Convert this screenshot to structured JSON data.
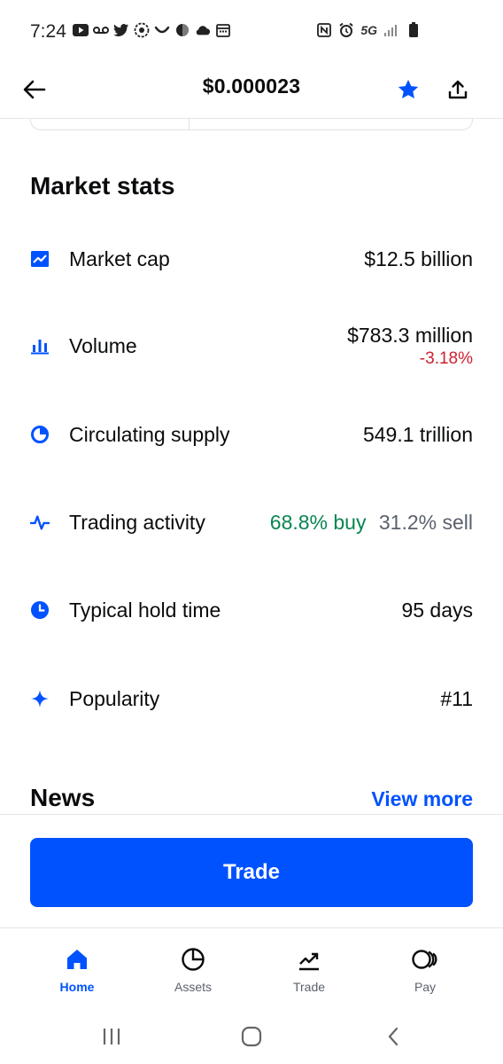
{
  "status_bar": {
    "time": "7:24",
    "network": "5G",
    "left_icons": [
      "youtube-icon",
      "voicemail-icon",
      "twitter-icon",
      "signal-app-icon",
      "smile-icon",
      "app-icon",
      "cloud-icon",
      "calendar-icon"
    ],
    "right_icons": [
      "nfc-icon",
      "alarm-icon",
      "network-5g-icon",
      "cell-signal-icon",
      "battery-icon"
    ]
  },
  "header": {
    "price": "$0.000023",
    "star_color": "#0052ff"
  },
  "market_stats": {
    "title": "Market stats",
    "rows": [
      {
        "icon": "line-chart-icon",
        "label": "Market cap",
        "value": "$12.5 billion"
      },
      {
        "icon": "bar-chart-icon",
        "label": "Volume",
        "value": "$783.3 million",
        "change": "-3.18%"
      },
      {
        "icon": "pie-chart-icon",
        "label": "Circulating supply",
        "value": "549.1 trillion"
      },
      {
        "icon": "pulse-icon",
        "label": "Trading activity",
        "buy": "68.8% buy",
        "sell": "31.2% sell"
      },
      {
        "icon": "clock-icon",
        "label": "Typical hold time",
        "value": "95 days"
      },
      {
        "icon": "sparkle-icon",
        "label": "Popularity",
        "value": "#11"
      }
    ]
  },
  "news": {
    "title": "News",
    "view_more": "View more"
  },
  "trade_button": "Trade",
  "bottom_nav": [
    {
      "label": "Home",
      "icon": "home-icon",
      "active": true
    },
    {
      "label": "Assets",
      "icon": "pie-chart-icon",
      "active": false
    },
    {
      "label": "Trade",
      "icon": "trend-up-icon",
      "active": false
    },
    {
      "label": "Pay",
      "icon": "pay-icon",
      "active": false
    }
  ],
  "colors": {
    "accent": "#0052ff",
    "positive": "#098551",
    "negative": "#cf202f",
    "muted": "#5b616e"
  }
}
